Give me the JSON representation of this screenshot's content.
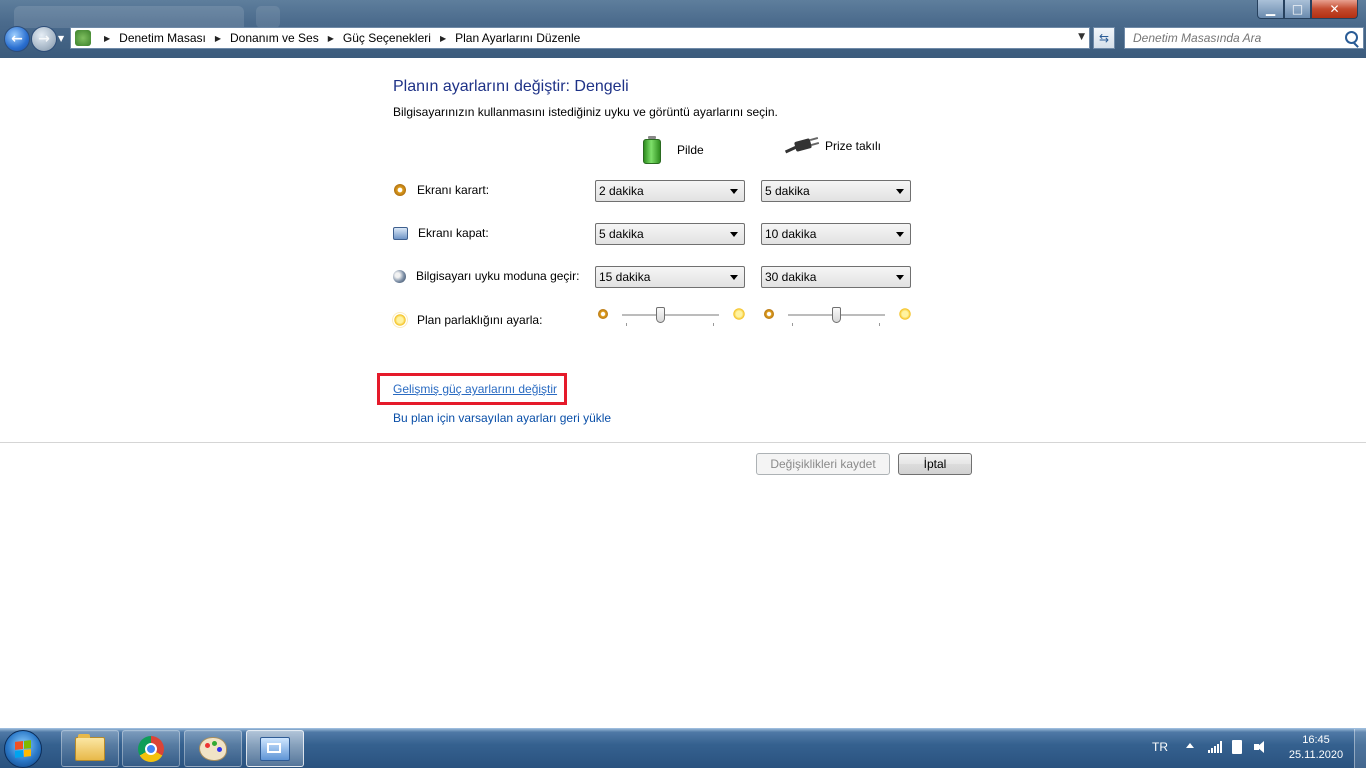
{
  "window": {
    "nav": {
      "back_icon": "back-arrow-icon",
      "forward_icon": "forward-arrow-icon"
    },
    "breadcrumbs": [
      "Denetim Masası",
      "Donanım ve Ses",
      "Güç Seçenekleri",
      "Plan Ayarlarını Düzenle"
    ],
    "search": {
      "placeholder": "Denetim Masasında Ara"
    },
    "controls": {
      "minimize": "▁",
      "maximize": "□",
      "close": "✕"
    }
  },
  "main": {
    "title": "Planın ayarlarını değiştir: Dengeli",
    "subtitle": "Bilgisayarınızın kullanmasını istediğiniz uyku ve görüntü ayarlarını seçin.",
    "columns": {
      "battery": "Pilde",
      "plugged": "Prize takılı"
    },
    "rows": [
      {
        "icon": "dim-display-icon",
        "label": "Ekranı karart:",
        "battery": "2 dakika",
        "plugged": "5 dakika"
      },
      {
        "icon": "display-off-icon",
        "label": "Ekranı kapat:",
        "battery": "5 dakika",
        "plugged": "10 dakika"
      },
      {
        "icon": "sleep-icon",
        "label": "Bilgisayarı uyku moduna geçir:",
        "battery": "15 dakika",
        "plugged": "30 dakika"
      }
    ],
    "brightness": {
      "label": "Plan parlaklığını ayarla:",
      "battery_level_pct": 40,
      "plugged_level_pct": 50
    },
    "links": {
      "advanced": "Gelişmiş güç ayarlarını değiştir",
      "restore": "Bu plan için varsayılan ayarları geri yükle"
    },
    "buttons": {
      "save": "Değişiklikleri kaydet",
      "cancel": "İptal"
    },
    "highlight_color": "#e51a2a"
  },
  "taskbar": {
    "apps": [
      "file-explorer-icon",
      "chrome-icon",
      "paint-icon",
      "control-panel-icon"
    ],
    "tray": {
      "language": "TR",
      "time": "16:45",
      "date": "25.11.2020"
    }
  }
}
